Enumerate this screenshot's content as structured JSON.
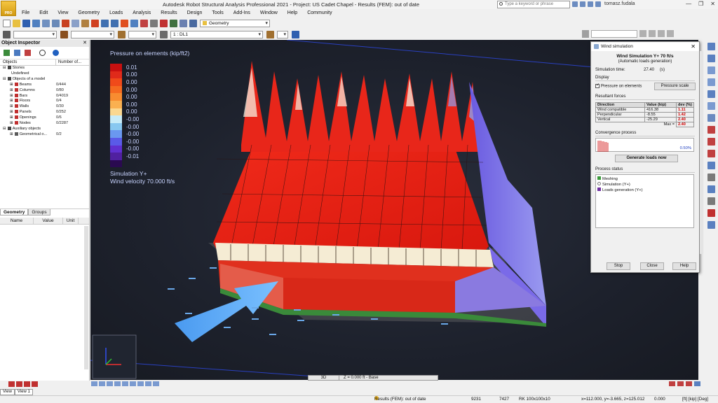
{
  "window": {
    "title": "Autodesk Robot Structural Analysis Professional 2021 - Project: US Cadet Chapel - Results (FEM): out of date",
    "search_placeholder": "Type a keyword or phrase",
    "user": "tomasz.fudala",
    "logo_text": "PRO"
  },
  "menu": [
    "File",
    "Edit",
    "View",
    "Geometry",
    "Loads",
    "Analysis",
    "Results",
    "Design",
    "Tools",
    "Add-Ins",
    "Window",
    "Help",
    "Community"
  ],
  "toolbar2": {
    "case_select": "1 : DL1",
    "layout_select": "Geometry"
  },
  "object_inspector": {
    "title": "Object Inspector",
    "col_objects": "Objects",
    "col_number": "Number of...",
    "tree": [
      {
        "label": "Stories",
        "value": "",
        "level": 1,
        "color": "#444"
      },
      {
        "label": "Undefined",
        "value": "",
        "level": 2,
        "color": ""
      },
      {
        "label": "Objects of a model",
        "value": "",
        "level": 1,
        "color": "#444"
      },
      {
        "label": "Beams",
        "value": "0/444",
        "level": 2,
        "color": "#c03030"
      },
      {
        "label": "Columns",
        "value": "0/80",
        "level": 2,
        "color": "#c03030"
      },
      {
        "label": "Bars",
        "value": "0/4019",
        "level": 2,
        "color": "#c03030"
      },
      {
        "label": "Floors",
        "value": "0/4",
        "level": 2,
        "color": "#c03030"
      },
      {
        "label": "Walls",
        "value": "0/30",
        "level": 2,
        "color": "#c03030"
      },
      {
        "label": "Panels",
        "value": "0/252",
        "level": 2,
        "color": "#c03030"
      },
      {
        "label": "Openings",
        "value": "0/6",
        "level": 2,
        "color": "#c03030"
      },
      {
        "label": "Nodes",
        "value": "0/2287",
        "level": 2,
        "color": "#c03030"
      },
      {
        "label": "Auxiliary objects",
        "value": "",
        "level": 1,
        "color": "#444"
      },
      {
        "label": "Geometrical o...",
        "value": "0/2",
        "level": 2,
        "color": "#5a5a5a"
      }
    ],
    "tabs": [
      "Geometry",
      "Groups"
    ],
    "prop_headers": [
      "Name",
      "Value",
      "Unit"
    ]
  },
  "viewport": {
    "legend_title": "Pressure on elements (kip/ft2)",
    "legend": [
      {
        "color": "#c81010",
        "label": "0.01"
      },
      {
        "color": "#e02a1a",
        "label": "0.00"
      },
      {
        "color": "#f04a1a",
        "label": "0.00"
      },
      {
        "color": "#f56a20",
        "label": "0.00"
      },
      {
        "color": "#f88c30",
        "label": "0.00"
      },
      {
        "color": "#fab050",
        "label": "0.00"
      },
      {
        "color": "#fbd890",
        "label": "0.00"
      },
      {
        "color": "#c8ecf8",
        "label": "-0.00"
      },
      {
        "color": "#88c8f0",
        "label": "-0.00"
      },
      {
        "color": "#6a98f0",
        "label": "-0.00"
      },
      {
        "color": "#5a5ae8",
        "label": "-0.00"
      },
      {
        "color": "#6030d0",
        "label": "-0.00"
      },
      {
        "color": "#5020a0",
        "label": "-0.01"
      },
      {
        "color": "#2a0a50",
        "label": ""
      }
    ],
    "sim_label": "Simulation Y+",
    "wind_velocity": "Wind velocity 70.000 ft/s",
    "view_mode": "3D",
    "level": "Z = 0.000 ft - Base"
  },
  "wind_dialog": {
    "title": "Wind simulation",
    "heading": "Wind Simulation Y+ 70 ft/s",
    "subheading": "(Automatic loads generation)",
    "sim_time_label": "Simulation time:",
    "sim_time_value": "27.40",
    "sim_time_unit": "(s)",
    "display_group": "Display",
    "pressure_checkbox": "Pressure on elements",
    "pressure_scale_btn": "Pressure scale",
    "resultant_group": "Resultant forces",
    "table_headers": [
      "Direction",
      "Value (kip)",
      "dev (%)"
    ],
    "rows": [
      {
        "dir": "Wind compatible",
        "value": "416.38",
        "dev": "1.11"
      },
      {
        "dir": "Perpendicular",
        "value": "-8.55",
        "dev": "1.42"
      },
      {
        "dir": "Vertical",
        "value": "-25.29",
        "dev": "2.40"
      }
    ],
    "max_label": "Max =",
    "max_value": "2.40",
    "convergence_group": "Convergence process",
    "convergence_pct": "0.50%",
    "generate_btn": "Generate loads now",
    "status_group": "Process status",
    "status_items": [
      "Meshing",
      "Simulation (Y+)",
      "Loads generation (Y+)"
    ],
    "stop_btn": "Stop",
    "close_btn": "Close",
    "help_btn": "Help"
  },
  "bottom_tabs": [
    "View",
    "View 1"
  ],
  "statusbar": {
    "results": "Results (FEM): out of date",
    "n1": "9231",
    "n2": "7427",
    "rk": "RK 100x100x10",
    "coords": "x=112.000, y=-3.665, z=125.012",
    "angle": "0.000",
    "units": "[ft] [kip] [Deg]"
  }
}
